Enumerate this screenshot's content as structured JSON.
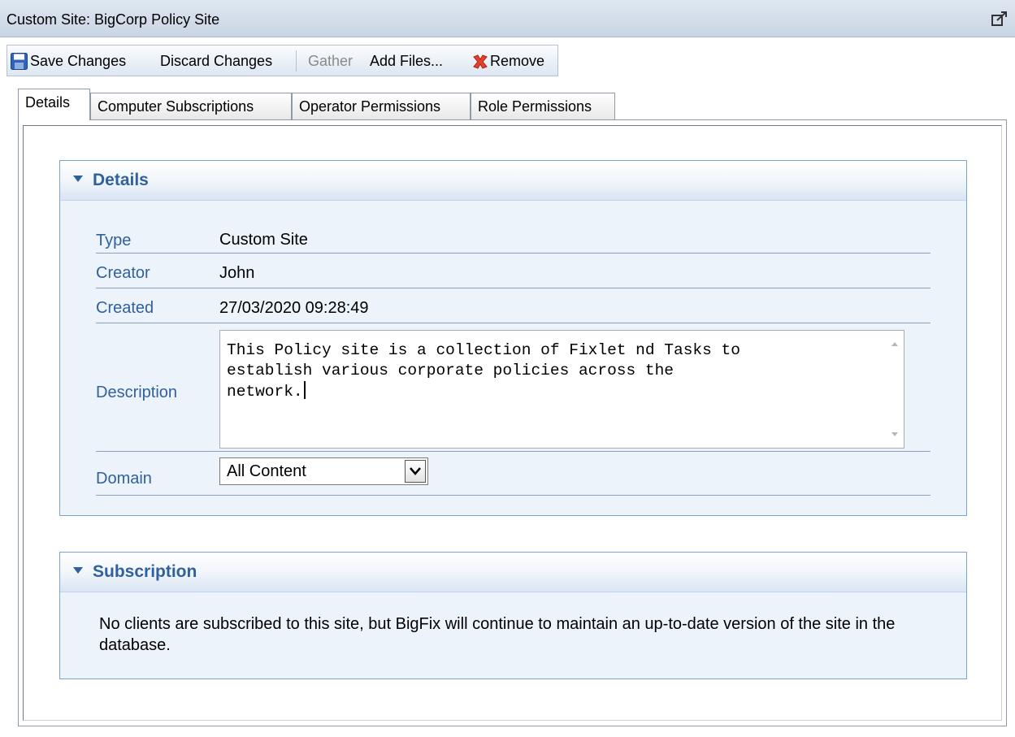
{
  "window": {
    "title": "Custom Site: BigCorp Policy Site"
  },
  "toolbar": {
    "save": "Save Changes",
    "discard": "Discard Changes",
    "gather": "Gather",
    "add_files": "Add Files...",
    "remove": "Remove"
  },
  "tabs": [
    {
      "label": "Details",
      "active": true
    },
    {
      "label": "Computer Subscriptions",
      "active": false
    },
    {
      "label": "Operator Permissions",
      "active": false
    },
    {
      "label": "Role Permissions",
      "active": false
    }
  ],
  "details": {
    "header": "Details",
    "type_label": "Type",
    "type_value": "Custom Site",
    "creator_label": "Creator",
    "creator_value": "John",
    "created_label": "Created",
    "created_value": "27/03/2020 09:28:49",
    "description_label": "Description",
    "description_value": "This Policy site is a collection of Fixlet nd Tasks to\nestablish various corporate policies across the\nnetwork.",
    "domain_label": "Domain",
    "domain_value": "All Content"
  },
  "subscription": {
    "header": "Subscription",
    "text": "No clients are subscribed to this site, but BigFix will continue to maintain an up-to-date version of the site in the database."
  },
  "colors": {
    "accent": "#30619e",
    "section_border": "#7aa4d6",
    "remove_red": "#e5412d"
  }
}
